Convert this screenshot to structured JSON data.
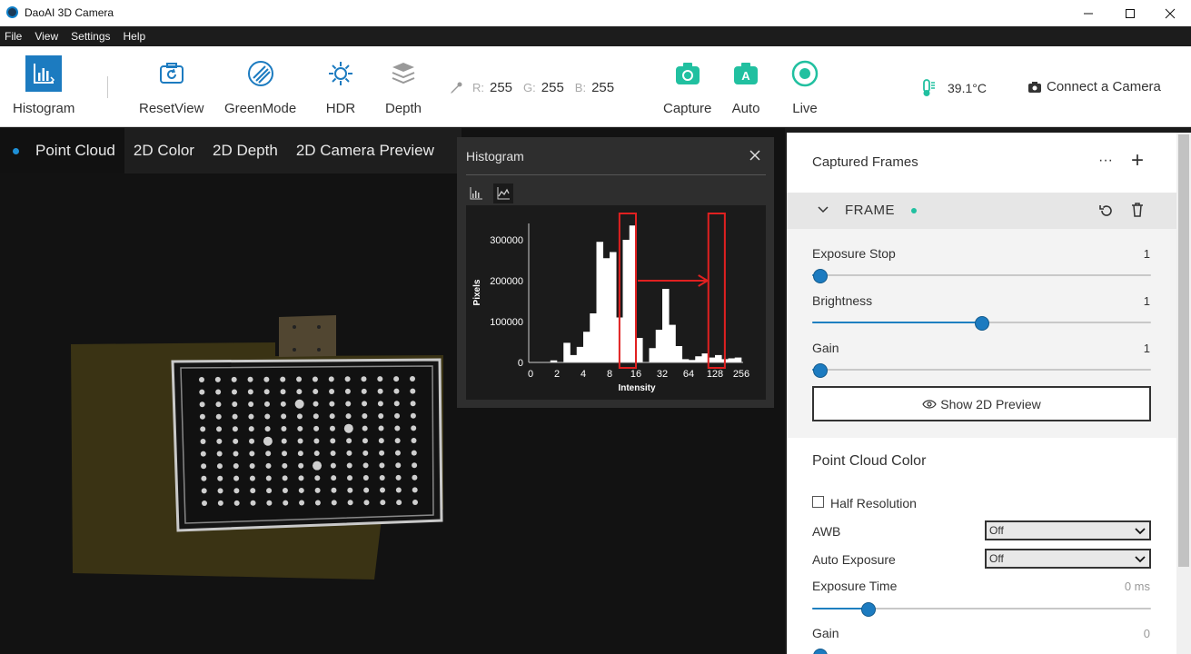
{
  "window": {
    "title": "DaoAI 3D Camera"
  },
  "menu": [
    "File",
    "View",
    "Settings",
    "Help"
  ],
  "toolbar": {
    "histogram": "Histogram",
    "reset_view": "ResetView",
    "green_mode": "GreenMode",
    "hdr": "HDR",
    "depth": "Depth",
    "rgb": {
      "r_label": "R:",
      "r": "255",
      "g_label": "G:",
      "g": "255",
      "b_label": "B:",
      "b": "255"
    },
    "capture": "Capture",
    "auto": "Auto",
    "live": "Live",
    "temperature": "39.1°C",
    "connect": "Connect a Camera"
  },
  "viewer": {
    "tabs": [
      "Point Cloud",
      "2D Color",
      "2D Depth",
      "2D Camera Preview"
    ],
    "active_tab": "Point Cloud"
  },
  "histogram_panel": {
    "title": "Histogram",
    "close_label": "×"
  },
  "chart_data": {
    "type": "bar",
    "xlabel": "Intensity",
    "ylabel": "Pixels",
    "x_ticks": [
      "0",
      "2",
      "4",
      "8",
      "16",
      "32",
      "64",
      "128",
      "256"
    ],
    "y_ticks": [
      "0",
      "100000",
      "200000",
      "300000"
    ],
    "ylim": [
      0,
      340000
    ],
    "bars": [
      {
        "i": 3,
        "v": 5000
      },
      {
        "i": 5,
        "v": 48000
      },
      {
        "i": 6,
        "v": 18000
      },
      {
        "i": 7,
        "v": 38000
      },
      {
        "i": 8,
        "v": 75000
      },
      {
        "i": 9,
        "v": 120000
      },
      {
        "i": 10,
        "v": 295000
      },
      {
        "i": 11,
        "v": 255000
      },
      {
        "i": 12,
        "v": 270000
      },
      {
        "i": 13,
        "v": 110000
      },
      {
        "i": 14,
        "v": 300000
      },
      {
        "i": 15,
        "v": 335000
      },
      {
        "i": 16,
        "v": 60000
      },
      {
        "i": 18,
        "v": 35000
      },
      {
        "i": 19,
        "v": 80000
      },
      {
        "i": 20,
        "v": 180000
      },
      {
        "i": 21,
        "v": 92000
      },
      {
        "i": 22,
        "v": 40000
      },
      {
        "i": 23,
        "v": 8000
      },
      {
        "i": 24,
        "v": 6000
      },
      {
        "i": 25,
        "v": 15000
      },
      {
        "i": 26,
        "v": 22000
      },
      {
        "i": 27,
        "v": 12000
      },
      {
        "i": 28,
        "v": 18000
      },
      {
        "i": 29,
        "v": 8000
      },
      {
        "i": 30,
        "v": 10000
      },
      {
        "i": 31,
        "v": 12000
      }
    ],
    "bins": 32,
    "annotations": [
      {
        "type": "box",
        "i_from": 13.5,
        "i_to": 16.0
      },
      {
        "type": "box",
        "i_from": 27.0,
        "i_to": 29.5
      },
      {
        "type": "arrow",
        "i_from": 16.0,
        "i_to": 27.0,
        "v": 200000
      }
    ]
  },
  "captured_frames": {
    "title": "Captured Frames",
    "more_label": "···",
    "add_label": "+",
    "frame_label": "FRAME",
    "params": [
      {
        "label": "Exposure Stop",
        "value": "1",
        "fraction": 0.0
      },
      {
        "label": "Brightness",
        "value": "1",
        "fraction": 0.5
      },
      {
        "label": "Gain",
        "value": "1",
        "fraction": 0.0
      }
    ],
    "preview_button": "Show 2D Preview"
  },
  "point_cloud_color": {
    "title": "Point Cloud Color",
    "half_resolution": "Half Resolution",
    "awb_label": "AWB",
    "awb_value": "Off",
    "auto_exposure_label": "Auto Exposure",
    "auto_exposure_value": "Off",
    "exposure_time_label": "Exposure Time",
    "exposure_time_value": "0 ms",
    "exposure_time_fraction": 0.15,
    "gain_label": "Gain",
    "gain_value": "0"
  },
  "colors": {
    "accent": "#1e7fc0",
    "teal": "#21c0a0",
    "highlight": "#e02020"
  }
}
